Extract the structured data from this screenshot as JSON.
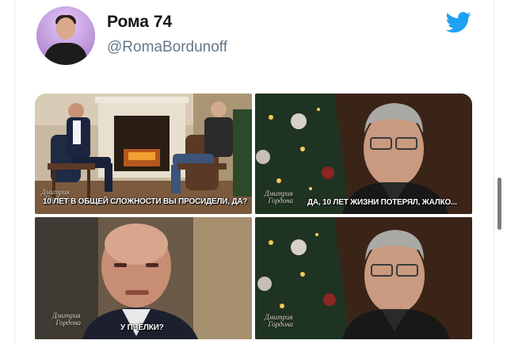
{
  "tweet": {
    "display_name": "Рома 74",
    "handle": "@RomaBordunoff",
    "brand_icon": "twitter-bird-icon",
    "brand_color": "#1da1f2"
  },
  "media": {
    "panels": [
      {
        "subtitle": "10 ЛЕТ В ОБЩЕЙ СЛОЖНОСТИ ВЫ ПРОСИДЕЛИ, ДА?",
        "logo": "В гостях у Дмитрия Гордона"
      },
      {
        "subtitle": "ДА, 10 ЛЕТ ЖИЗНИ ПОТЕРЯЛ, ЖАЛКО...",
        "logo": "В гостях у Дмитрия Гордона"
      },
      {
        "subtitle": "У ПЧЁЛКИ?",
        "logo": "В гостях у Дмитрия Гордона"
      },
      {
        "subtitle": "",
        "logo": "В гостях у Дмитрия Гордона"
      }
    ]
  }
}
